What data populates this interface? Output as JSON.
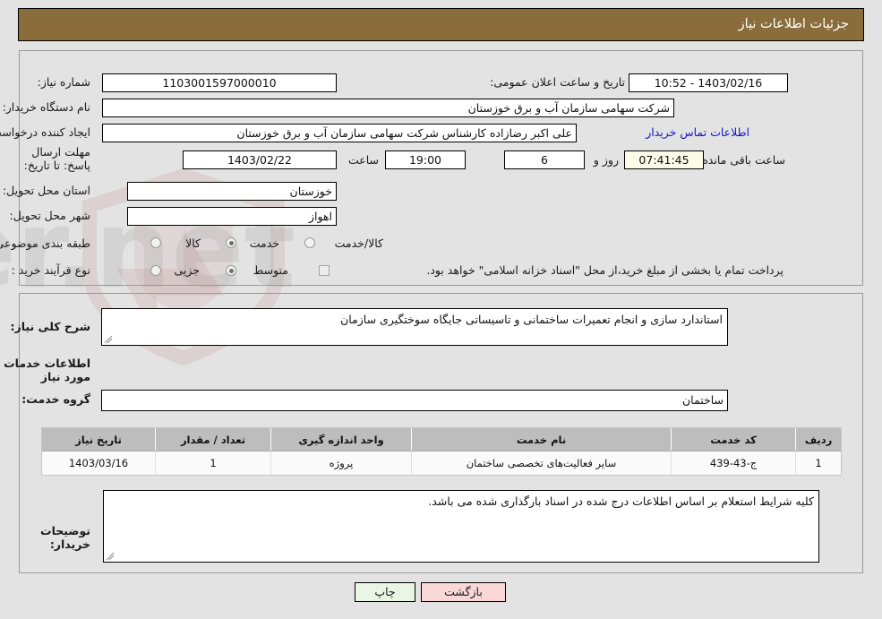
{
  "header": {
    "title": "جزئیات اطلاعات نیاز"
  },
  "top_section": {
    "need_number": {
      "label": "شماره نیاز:",
      "value": "1103001597000010"
    },
    "announce_datetime": {
      "label": "تاریخ و ساعت اعلان عمومی:",
      "value": "1403/02/16 - 10:52"
    },
    "buyer_org": {
      "label": "نام دستگاه خریدار:",
      "value": "شرکت سهامی سازمان آب و برق خوزستان"
    },
    "request_creator": {
      "label": "ایجاد کننده درخواست:",
      "value": "علی اکبر رضازاده کارشناس شرکت سهامی سازمان آب و برق خوزستان"
    },
    "buyer_contact_link": "اطلاعات تماس خریدار",
    "deadline": {
      "label": "مهلت ارسال پاسخ: تا تاریخ:",
      "date": "1403/02/22",
      "hour_label": "ساعت",
      "hour": "19:00",
      "days_remaining": "6",
      "days_unit_label": "روز و",
      "countdown": "07:41:45",
      "countdown_suffix_label": "ساعت باقی مانده"
    },
    "delivery_province": {
      "label": "استان محل تحویل:",
      "value": "خوزستان"
    },
    "delivery_city": {
      "label": "شهر محل تحویل:",
      "value": "اهواز"
    },
    "subject_category": {
      "label": "طبقه بندی موضوعی:",
      "options": [
        "کالا",
        "خدمت",
        "کالا/خدمت"
      ],
      "selected": "خدمت"
    },
    "purchase_process": {
      "label": "نوع فرآیند خرید :",
      "options": [
        "جزیی",
        "متوسط"
      ],
      "selected": "متوسط"
    },
    "treasury_note": {
      "text": "پرداخت تمام یا بخشی از مبلغ خرید،از محل \"اسناد خزانه اسلامی\" خواهد بود.",
      "checked": false
    }
  },
  "bottom_section": {
    "general_desc": {
      "label": "شرح کلی نیاز:",
      "value": "استاندارد سازی و انجام تعمیرات ساختمانی و تاسیساتی جایگاه سوختگیری سازمان"
    },
    "services_info_title": "اطلاعات خدمات مورد نیاز",
    "service_group": {
      "label": "گروه خدمت:",
      "value": "ساختمان"
    },
    "table": {
      "columns": [
        "ردیف",
        "کد خدمت",
        "نام خدمت",
        "واحد اندازه گیری",
        "تعداد / مقدار",
        "تاریخ نیاز"
      ],
      "rows": [
        [
          "1",
          "ج-43-439",
          "سایر فعالیت‌های تخصصی ساختمان",
          "پروژه",
          "1",
          "1403/03/16"
        ]
      ]
    },
    "buyer_notes": {
      "label": "توضیحات خریدار:",
      "value": "کلیه شرایط استعلام بر اساس اطلاعات درج شده در اسناد بارگذاری شده می باشد."
    }
  },
  "footer": {
    "print_label": "چاپ",
    "back_label": "بازگشت"
  },
  "watermark": {
    "text": "AriaTender.net"
  },
  "colors": {
    "header_bg": "#8a6d3b",
    "page_bg": "#e3e3e3",
    "link": "#1414d2",
    "print_btn": "#e9f6e4",
    "back_btn": "#f9d7d7",
    "table_header": "#bdbdbd",
    "countdown_bg": "#fbfbe8"
  }
}
